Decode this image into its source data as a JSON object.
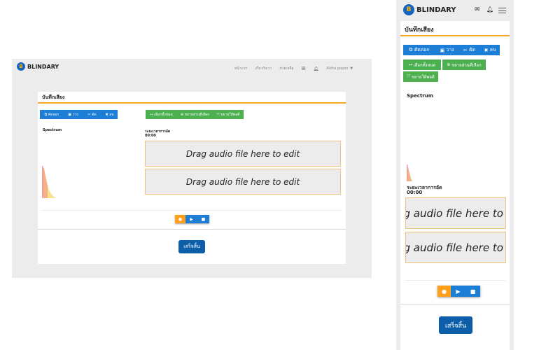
{
  "brand": {
    "name": "BLINDARY"
  },
  "nav": {
    "links": [
      "หน้าแรก",
      "เกี่ยวกับเรา",
      "ช่วยเหลือ"
    ],
    "user": "Aloha popoo"
  },
  "page": {
    "title": "บันทึกเสียง"
  },
  "toolbar": {
    "copy": "คัดลอก",
    "paste": "วาง",
    "cut": "ตัด",
    "delete": "ลบ",
    "select_all": "เลือกทั้งหมด",
    "expand": "ขยายส่วนที่เลือก",
    "fit": "ขยายให้พอดี"
  },
  "spectrum": {
    "label": "Spectrum"
  },
  "duration": {
    "label": "ระยะเวลาการอัด",
    "value": "00:00"
  },
  "dropzones": [
    "Drag audio file here to edit",
    "Drag audio file here to edit"
  ],
  "finish": {
    "label": "เสร็จสิ้น"
  },
  "mobile": {
    "select_all": "เลือกทั้งหมด",
    "expand": "ขยายส่วนที่เลือก",
    "fit": "ขยายให้พอดี"
  }
}
